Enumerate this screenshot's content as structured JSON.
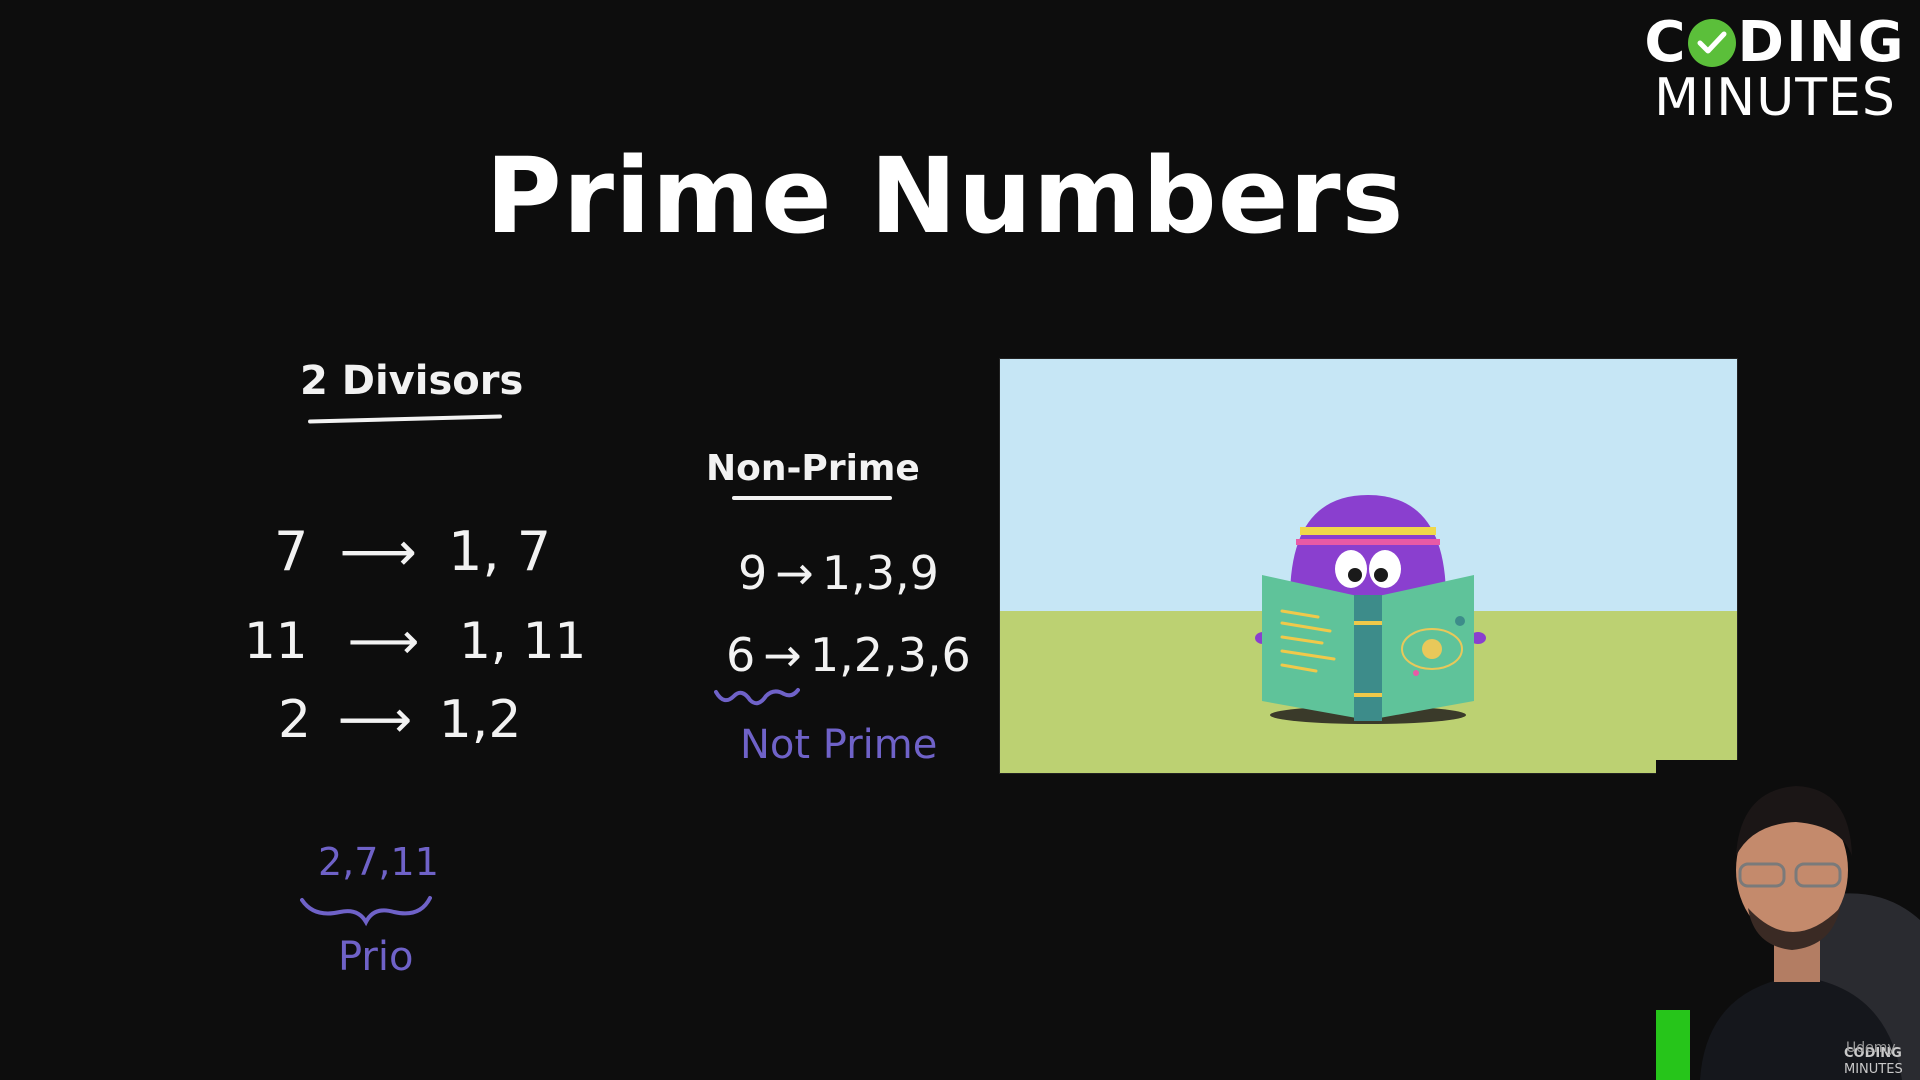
{
  "logo": {
    "line1_left": "C",
    "line1_right": "DING",
    "line2": "MINUTES",
    "check_color": "#5bbf3a"
  },
  "title": "Prime Numbers",
  "left_notes": {
    "heading": "2 Divisors",
    "rows": [
      {
        "n": "7",
        "arrow": "⟶",
        "divisors": "1, 7"
      },
      {
        "n": "11",
        "arrow": "⟶",
        "divisors": "1, 11"
      },
      {
        "n": "2",
        "arrow": "⟶",
        "divisors": "1,2"
      }
    ],
    "primes_list": "2,7,11",
    "primes_label": "Prio"
  },
  "middle_notes": {
    "heading": "Non-Prime",
    "rows": [
      {
        "n": "9",
        "arrow": "→",
        "divisors": "1,3,9"
      },
      {
        "n": "6",
        "arrow": "→",
        "divisors": "1,2,3,6"
      }
    ],
    "note": "Not Prime"
  },
  "video_overlay": {
    "sky_color": "#c6e6f5",
    "grass_color": "#bcd172",
    "character_color": "#8a3fcf"
  },
  "presenter_badge": {
    "line1": "CODING",
    "line2": "MINUTES",
    "watermark": "Udemy"
  },
  "colors": {
    "background": "#0d0d0d",
    "ink_white": "#f2f2f2",
    "ink_purple": "#6f62c8"
  }
}
